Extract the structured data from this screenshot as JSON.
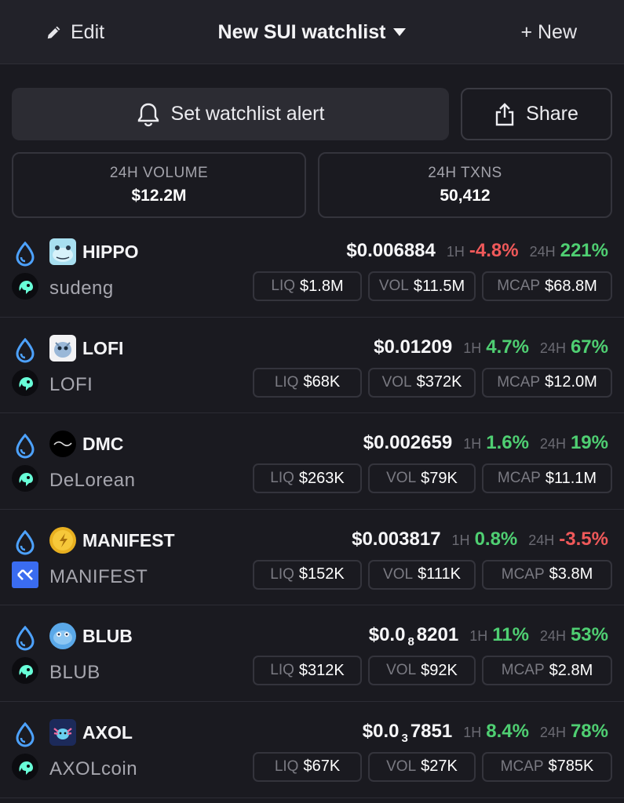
{
  "header": {
    "edit_label": "Edit",
    "title": "New SUI watchlist",
    "new_label": "+ New"
  },
  "actions": {
    "alert_label": "Set watchlist alert",
    "share_label": "Share"
  },
  "stats": {
    "volume_label": "24H VOLUME",
    "volume_value": "$12.2M",
    "txns_label": "24H TXNS",
    "txns_value": "50,412"
  },
  "labels": {
    "h1": "1H",
    "h24": "24H",
    "liq": "LIQ",
    "vol": "VOL",
    "mcap": "MCAP"
  },
  "tokens": [
    {
      "symbol": "HIPPO",
      "name": "sudeng",
      "price_main": "$0.006884",
      "price_sub": "",
      "price_tail": "",
      "change_1h": "-4.8%",
      "change_24h": "221%",
      "liq": "$1.8M",
      "vol": "$11.5M",
      "mcap": "$68.8M",
      "icon": "hippo-icon",
      "dex": "cetus-icon"
    },
    {
      "symbol": "LOFI",
      "name": "LOFI",
      "price_main": "$0.01209",
      "price_sub": "",
      "price_tail": "",
      "change_1h": "4.7%",
      "change_24h": "67%",
      "liq": "$68K",
      "vol": "$372K",
      "mcap": "$12.0M",
      "icon": "lofi-icon",
      "dex": "cetus-icon"
    },
    {
      "symbol": "DMC",
      "name": "DeLorean",
      "price_main": "$0.002659",
      "price_sub": "",
      "price_tail": "",
      "change_1h": "1.6%",
      "change_24h": "19%",
      "liq": "$263K",
      "vol": "$79K",
      "mcap": "$11.1M",
      "icon": "dmc-icon",
      "dex": "cetus-icon"
    },
    {
      "symbol": "MANIFEST",
      "name": "MANIFEST",
      "price_main": "$0.003817",
      "price_sub": "",
      "price_tail": "",
      "change_1h": "0.8%",
      "change_24h": "-3.5%",
      "liq": "$152K",
      "vol": "$111K",
      "mcap": "$3.8M",
      "icon": "manifest-icon",
      "dex": "aftermath-icon"
    },
    {
      "symbol": "BLUB",
      "name": "BLUB",
      "price_main": "$0.0",
      "price_sub": "8",
      "price_tail": "8201",
      "change_1h": "11%",
      "change_24h": "53%",
      "liq": "$312K",
      "vol": "$92K",
      "mcap": "$2.8M",
      "icon": "blub-icon",
      "dex": "cetus-icon"
    },
    {
      "symbol": "AXOL",
      "name": "AXOLcoin",
      "price_main": "$0.0",
      "price_sub": "3",
      "price_tail": "7851",
      "change_1h": "8.4%",
      "change_24h": "78%",
      "liq": "$67K",
      "vol": "$27K",
      "mcap": "$785K",
      "icon": "axol-icon",
      "dex": "cetus-icon"
    }
  ],
  "colors": {
    "positive": "#4fcf72",
    "negative": "#f0595a",
    "sui_blue": "#4da2ff",
    "cetus_green": "#68ffd8"
  }
}
